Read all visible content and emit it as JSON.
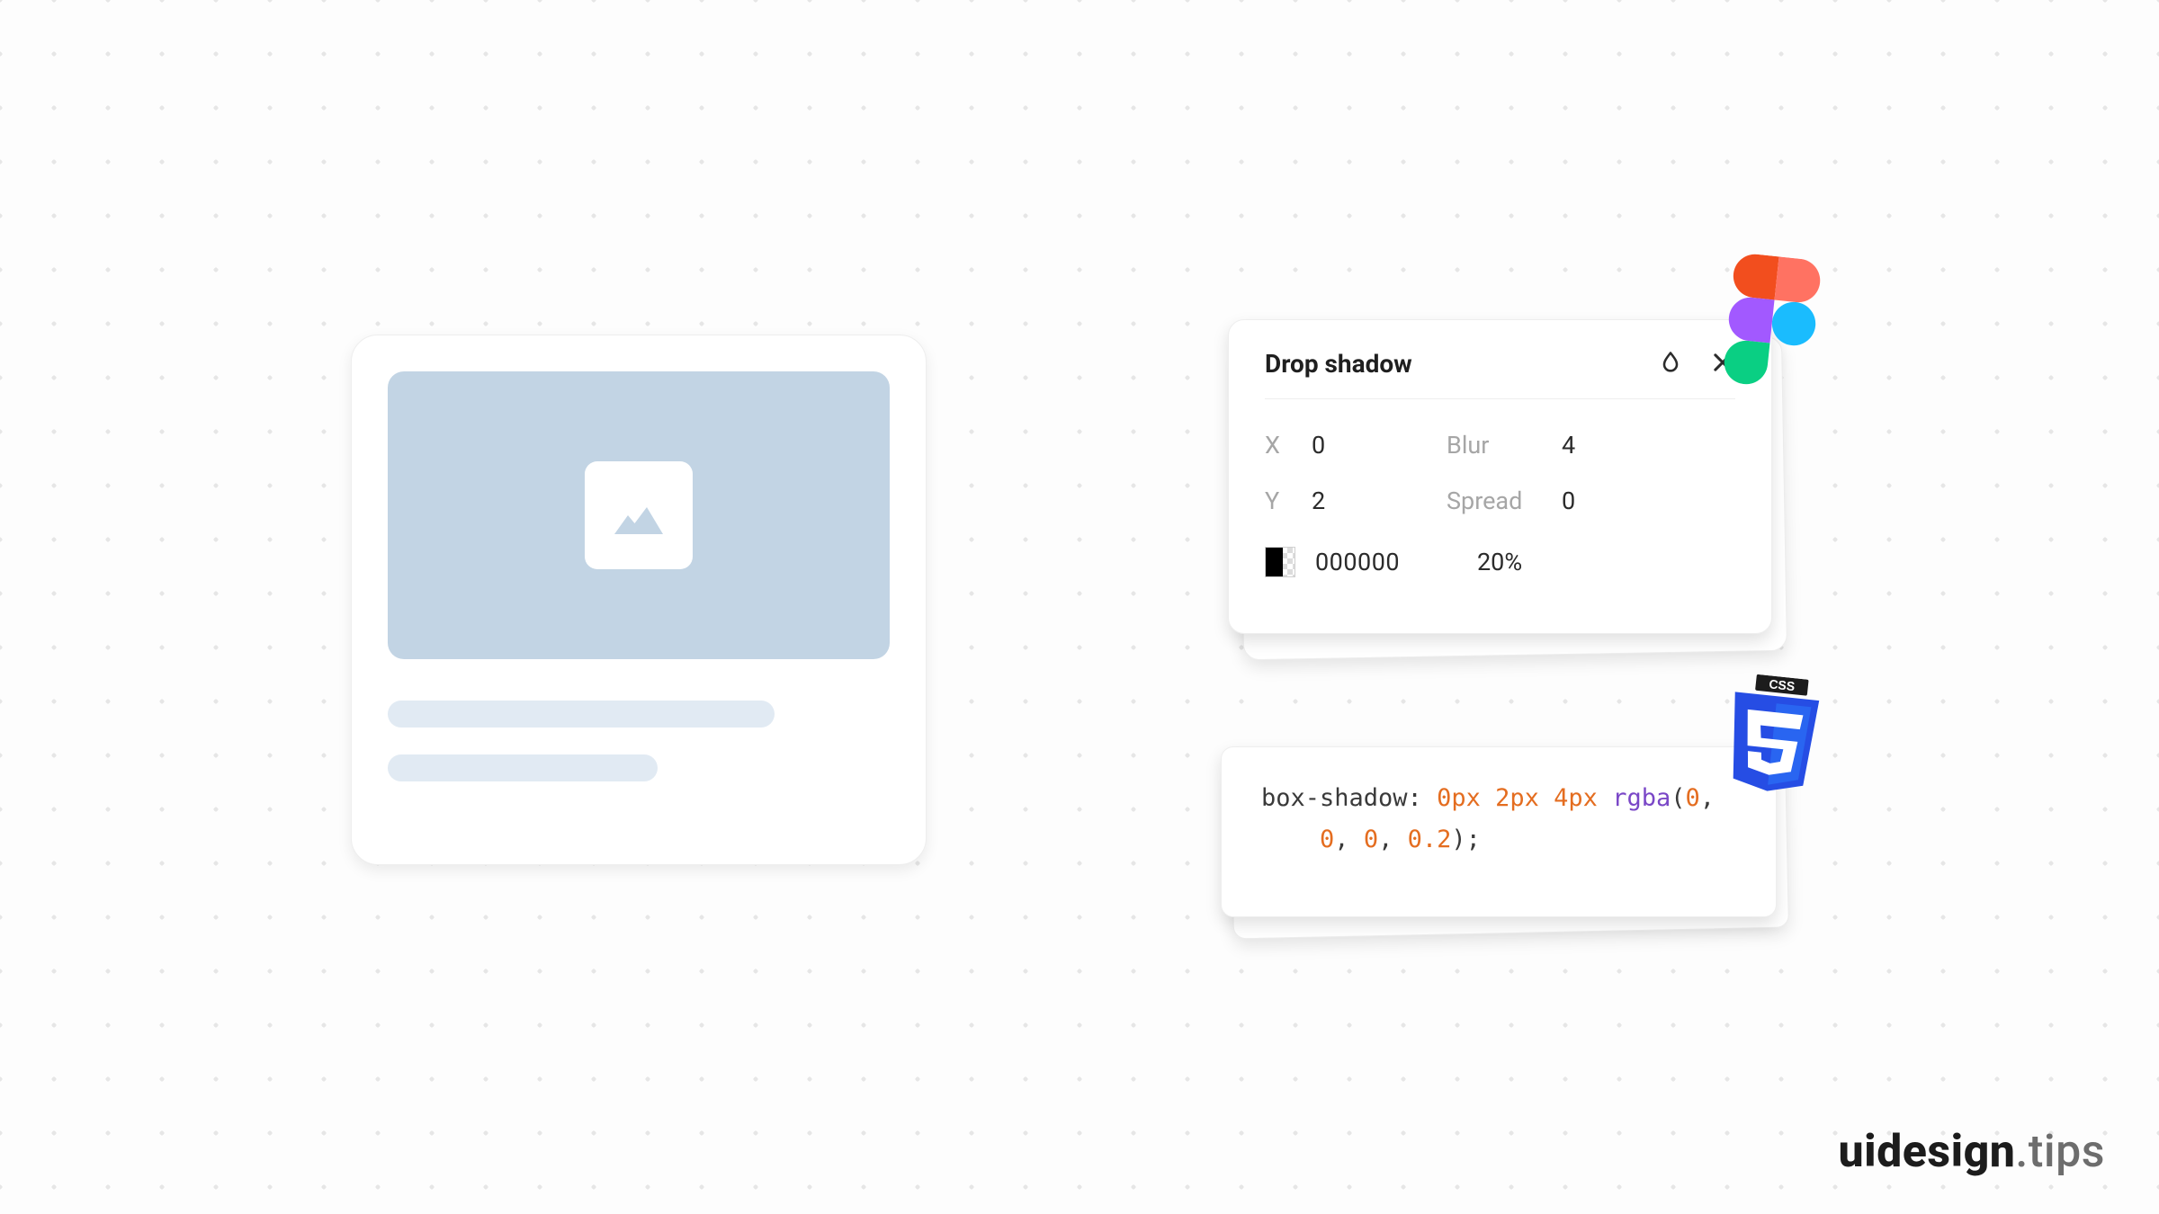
{
  "figma_panel": {
    "title": "Drop shadow",
    "x_label": "X",
    "x_value": "0",
    "y_label": "Y",
    "y_value": "2",
    "blur_label": "Blur",
    "blur_value": "4",
    "spread_label": "Spread",
    "spread_value": "0",
    "color_hex": "000000",
    "opacity": "20%"
  },
  "css_code": {
    "prop": "box-shadow: ",
    "v0": "0px",
    "v1": "2px",
    "v2": "4px",
    "func": "rgba",
    "a0": "0",
    "a1": "0",
    "a2": "0",
    "a3": "0.2"
  },
  "brand": {
    "name": "uidesign",
    "suffix": ".tips"
  }
}
